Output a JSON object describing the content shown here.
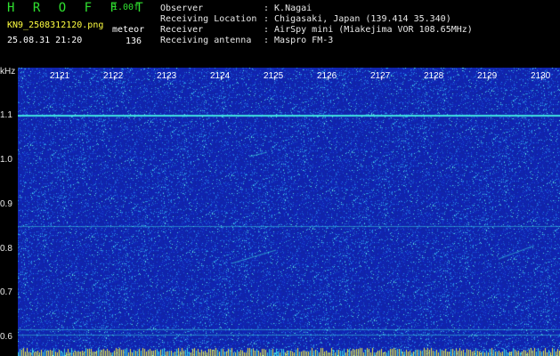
{
  "app": {
    "name": "H R O F F T",
    "version": "1.00f",
    "filename": "KN9_2508312120.png",
    "timestamp": "25.08.31 21:20",
    "mode_label": "meteor",
    "count": "136"
  },
  "meta": {
    "observer_label": "Observer",
    "observer_value": ": K.Nagai",
    "location_label": "Receiving Location",
    "location_value": ": Chigasaki, Japan (139.414 35.340)",
    "receiver_label": "Receiver",
    "receiver_value": ": AirSpy mini (Miakejima VOR 108.65MHz)",
    "antenna_label": "Receiving antenna",
    "antenna_value": ": Maspro FM-3"
  },
  "axis": {
    "unit": "kHz",
    "y_labels": [
      "1.1",
      "1.0",
      "0.9",
      "0.8",
      "0.7",
      "0.6"
    ],
    "time_labels": [
      "2121",
      "2122",
      "2123",
      "2124",
      "2125",
      "2126",
      "2127",
      "2128",
      "2129",
      "2130"
    ]
  },
  "colors": {
    "background": "#1426a8",
    "signal_cyan": "#3ee0e0",
    "signal_yellow": "#f0f040",
    "header_green": "#2fe02f"
  }
}
